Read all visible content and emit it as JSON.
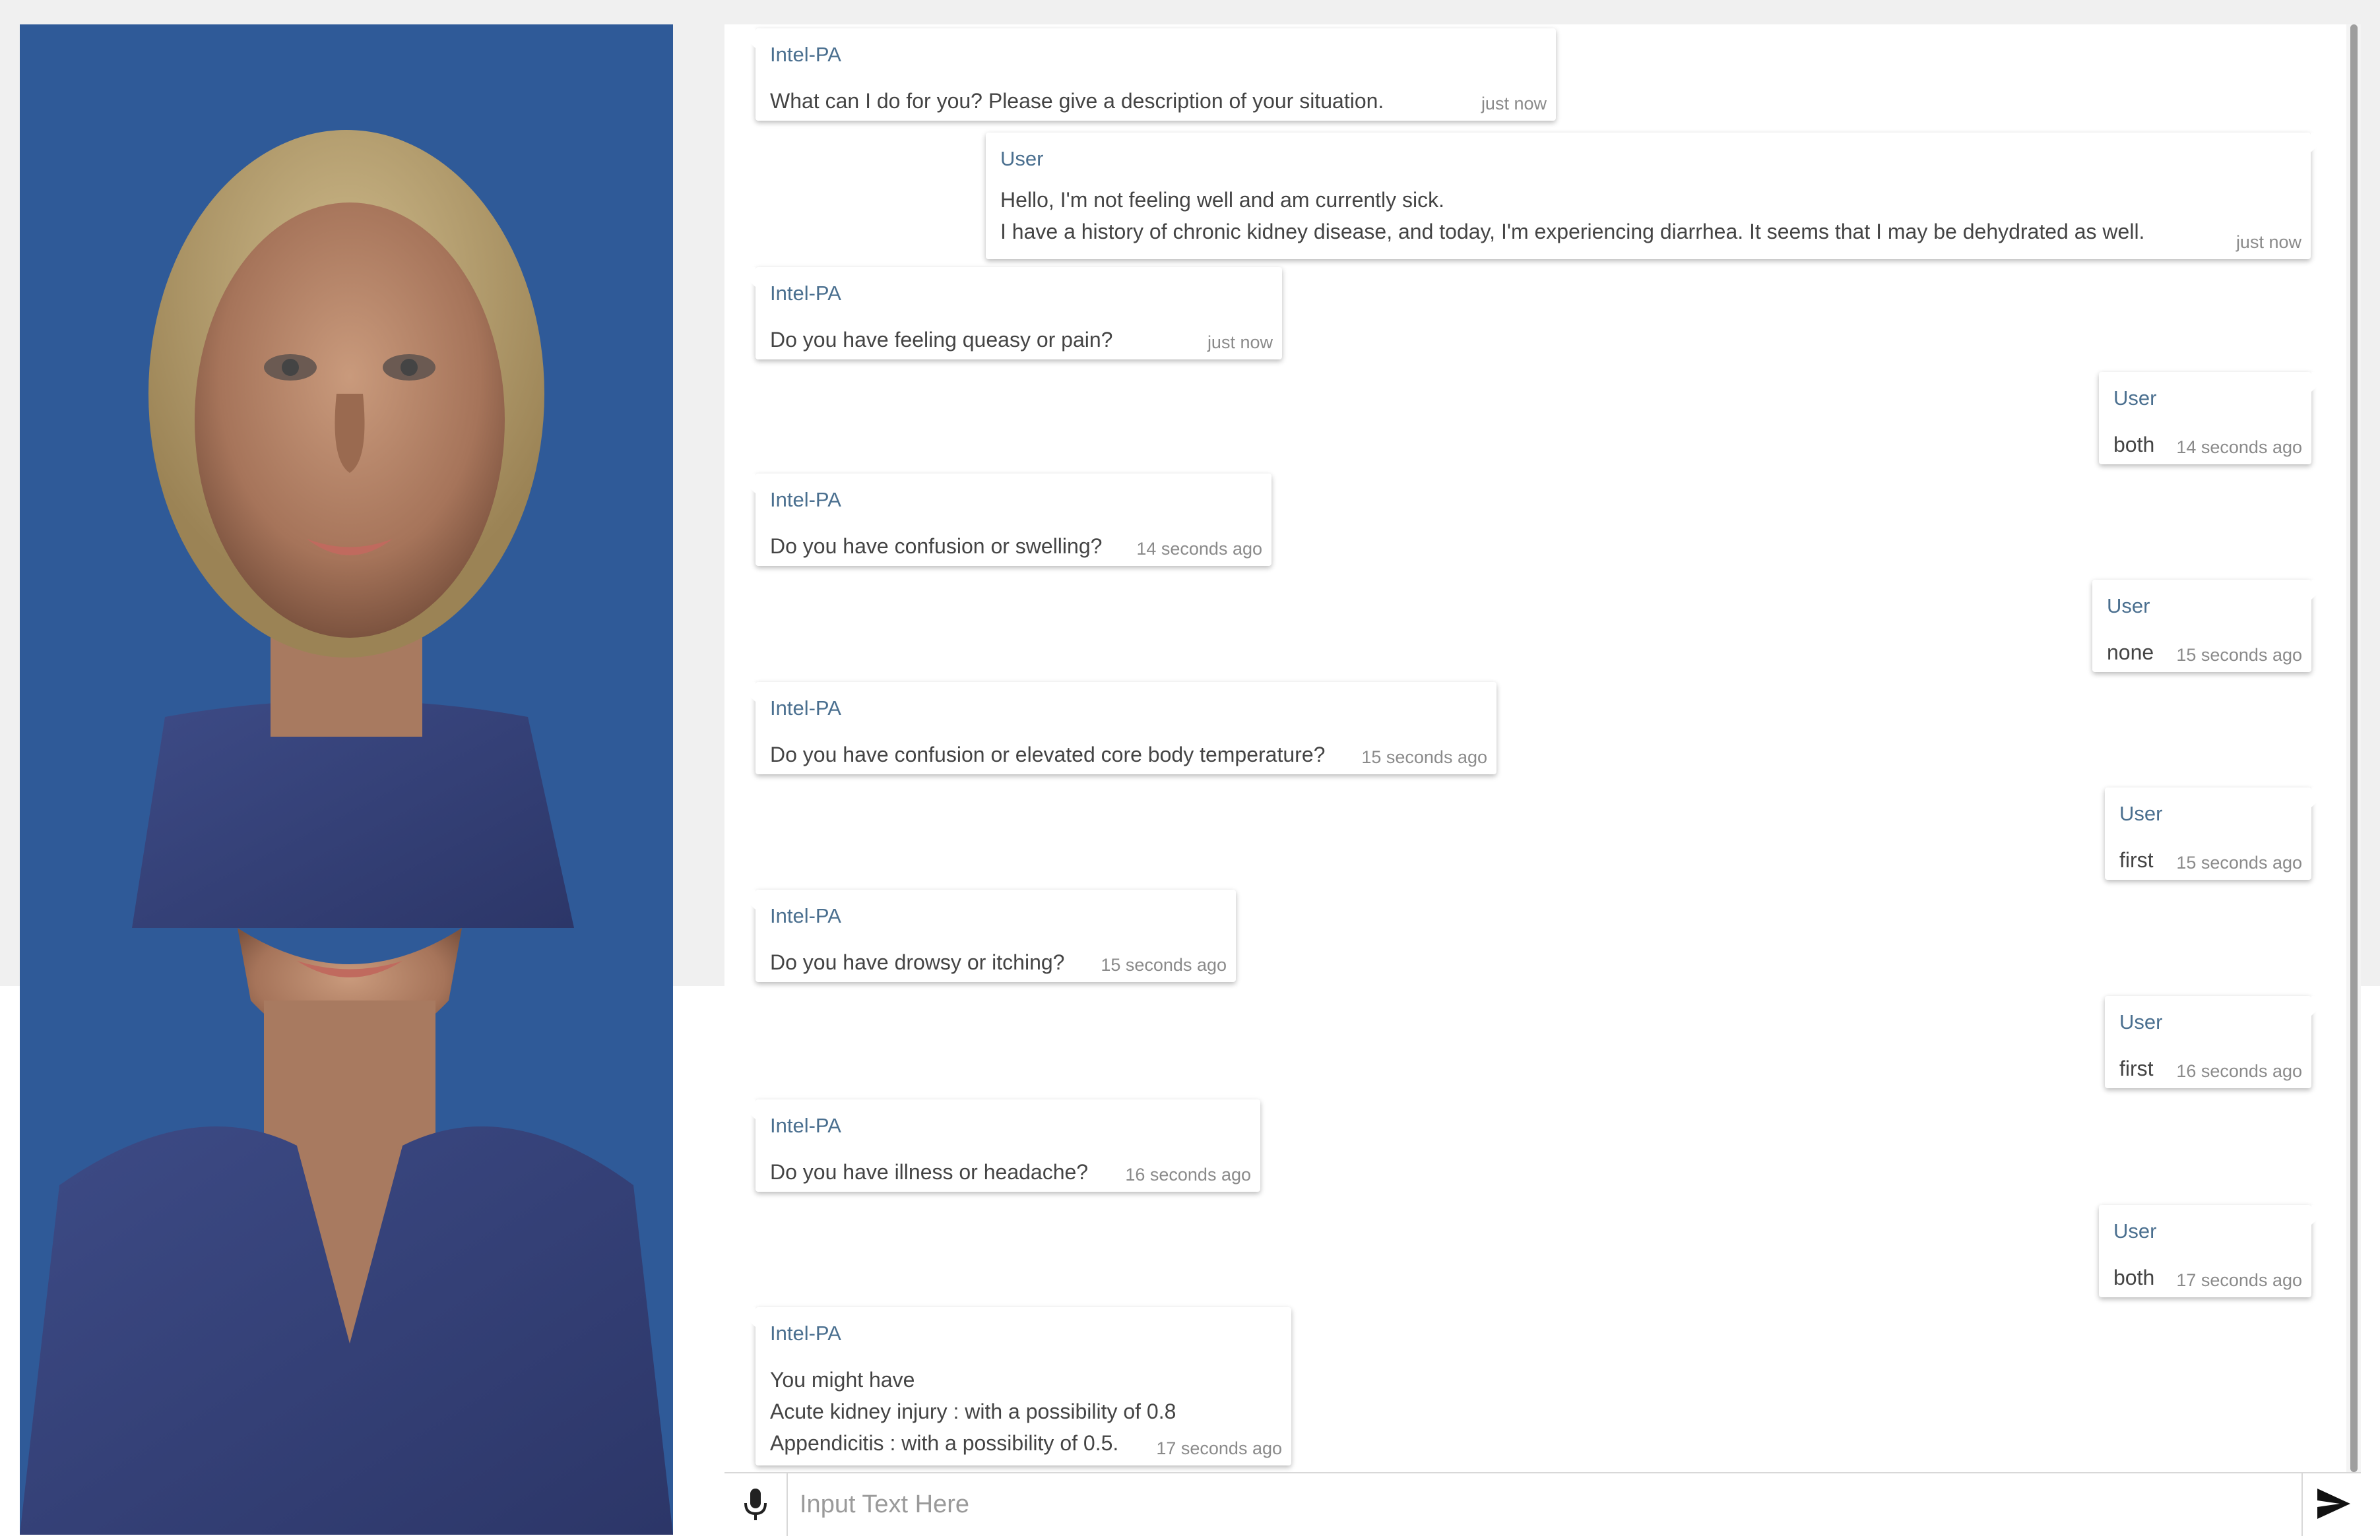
{
  "chat": {
    "messages": [
      {
        "sender": "Intel-PA",
        "text": "What can I do for you? Please give a description of your situation.",
        "time": "just now"
      },
      {
        "sender": "User",
        "text": "Hello, I'm not feeling well and am currently sick.\nI have a history of chronic kidney disease, and today, I'm experiencing diarrhea. It seems that I may be dehydrated as well.",
        "time": "just now"
      },
      {
        "sender": "Intel-PA",
        "text": "Do you have feeling queasy or pain?",
        "time": "just now"
      },
      {
        "sender": "User",
        "text": "both",
        "time": "14 seconds ago"
      },
      {
        "sender": "Intel-PA",
        "text": "Do you have confusion or swelling?",
        "time": "14 seconds ago"
      },
      {
        "sender": "User",
        "text": "none",
        "time": "15 seconds ago"
      },
      {
        "sender": "Intel-PA",
        "text": "Do you have confusion or elevated core body temperature?",
        "time": "15 seconds ago"
      },
      {
        "sender": "User",
        "text": "first",
        "time": "15 seconds ago"
      },
      {
        "sender": "Intel-PA",
        "text": "Do you have drowsy or itching?",
        "time": "15 seconds ago"
      },
      {
        "sender": "User",
        "text": "first",
        "time": "16 seconds ago"
      },
      {
        "sender": "Intel-PA",
        "text": "Do you have illness or headache?",
        "time": "16 seconds ago"
      },
      {
        "sender": "User",
        "text": "both",
        "time": "17 seconds ago"
      },
      {
        "sender": "Intel-PA",
        "text": "You might have\nAcute kidney injury : with a possibility of 0.8\nAppendicitis : with a possibility of 0.5.",
        "time": "17 seconds ago"
      }
    ]
  },
  "input": {
    "placeholder": "Input Text Here",
    "value": ""
  },
  "icons": {
    "mic": "microphone-icon",
    "send": "send-icon"
  },
  "colors": {
    "sender_name": "#4a6f8f",
    "avatar_background": "#2f5a98"
  }
}
